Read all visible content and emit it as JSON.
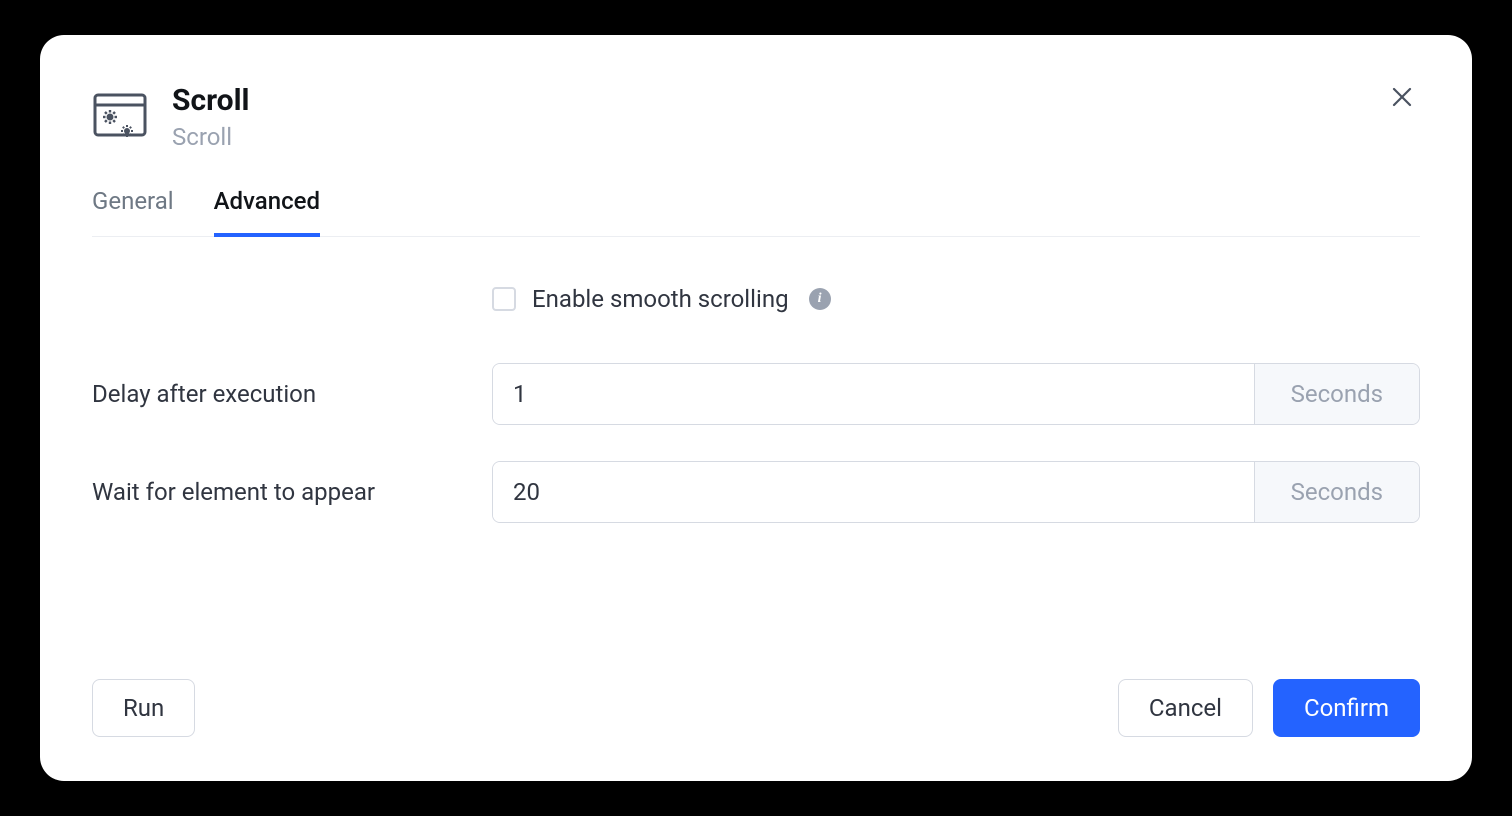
{
  "header": {
    "title": "Scroll",
    "subtitle": "Scroll"
  },
  "tabs": {
    "general": "General",
    "advanced": "Advanced"
  },
  "form": {
    "smooth_scroll_label": "Enable smooth scrolling",
    "delay_label": "Delay after execution",
    "delay_value": "1",
    "delay_unit": "Seconds",
    "wait_label": "Wait for element to appear",
    "wait_value": "20",
    "wait_unit": "Seconds"
  },
  "footer": {
    "run": "Run",
    "cancel": "Cancel",
    "confirm": "Confirm"
  }
}
